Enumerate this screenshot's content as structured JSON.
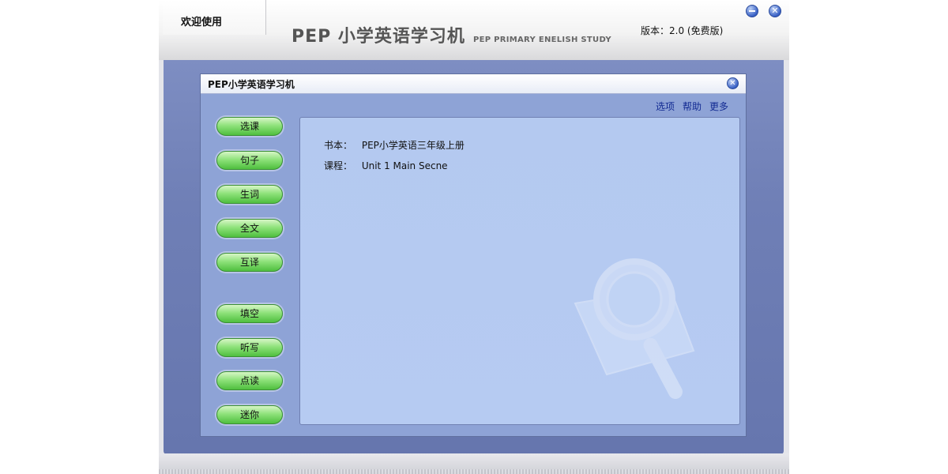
{
  "header": {
    "welcome": "欢迎使用",
    "logo_main": "PEP 小学英语学习机",
    "logo_sub": "PEP PRIMARY ENELISH STUDY",
    "version": "版本：2.0 (免费版)"
  },
  "window_controls": {
    "minimize_icon": "minimize-icon",
    "close_icon": "close-icon"
  },
  "dialog": {
    "title": "PEP小学英语学习机",
    "links": [
      "选项",
      "帮助",
      "更多"
    ],
    "book_label": "书本：",
    "book_value": "PEP小学英语三年级上册",
    "lesson_label": "课程：",
    "lesson_value": "Unit 1 Main Secne"
  },
  "sidebar": {
    "buttons": [
      "选课",
      "句子",
      "生词",
      "全文",
      "互译",
      "填空",
      "听写",
      "点读",
      "迷你"
    ]
  },
  "colors": {
    "accent_green": "#5fcf4a",
    "panel_blue": "#b4c9f0",
    "link_blue": "#122a92",
    "stage_blue": "#7080b6"
  }
}
